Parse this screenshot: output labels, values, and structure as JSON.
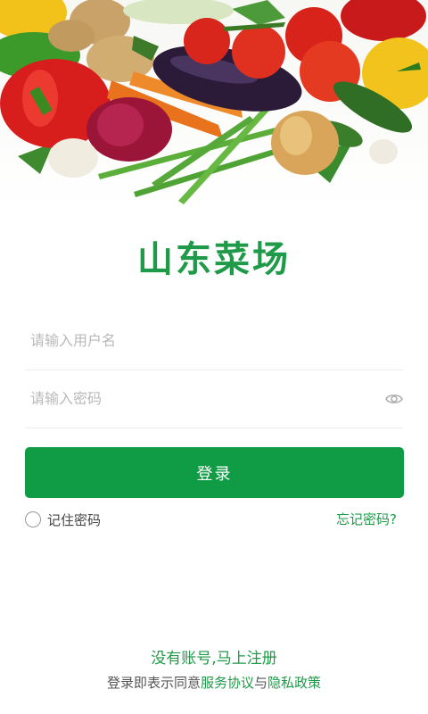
{
  "app": {
    "title": "山东菜场"
  },
  "hero": {
    "image": "vegetables-banner"
  },
  "login_form": {
    "username_placeholder": "请输入用户名",
    "username_value": "",
    "password_placeholder": "请输入密码",
    "password_value": "",
    "show_password_icon": "eye-icon",
    "login_button": "登录",
    "remember_label": "记住密码",
    "remember_checked": false,
    "forgot_link": "忘记密码?"
  },
  "footer": {
    "register_link": "没有账号,马上注册",
    "agreement_prefix": "登录即表示同意",
    "service_agreement": "服务协议",
    "and_text": "与",
    "privacy_policy": "隐私政策"
  },
  "colors": {
    "brand_green": "#109b45",
    "text_green": "#1f9a48",
    "placeholder": "#b9b9b9"
  }
}
